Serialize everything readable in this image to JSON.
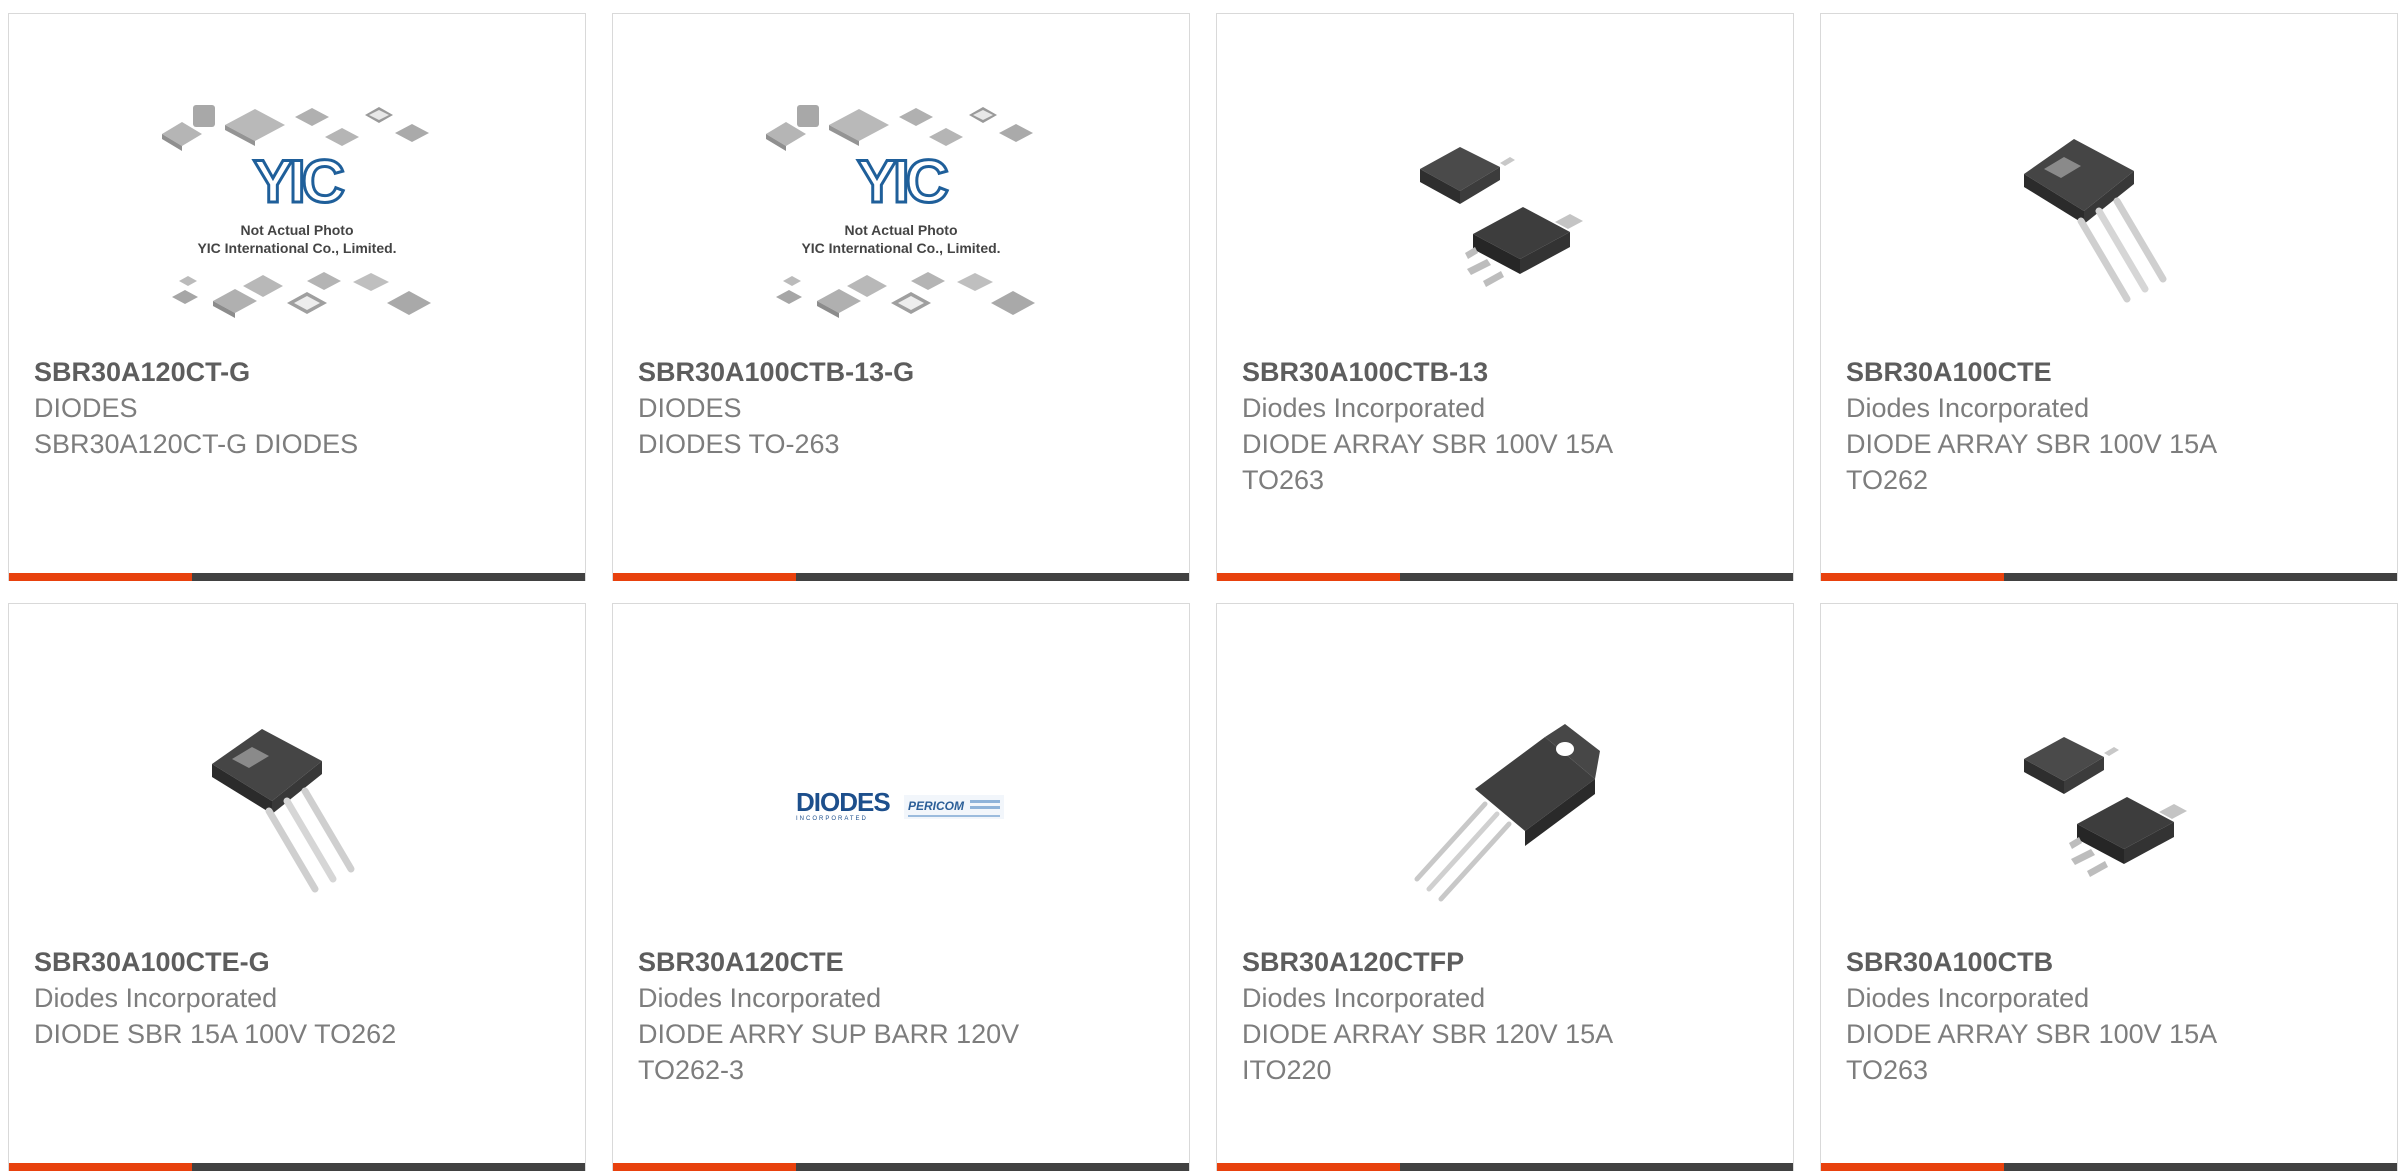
{
  "colors": {
    "accent": "#e8410d",
    "bar_dark": "#414141",
    "title_text": "#5d5d5d",
    "body_text": "#7d7d7d",
    "border": "#d9d9d9"
  },
  "products": [
    {
      "part_number": "SBR30A120CT-G",
      "manufacturer": "DIODES",
      "description": "SBR30A120CT-G DIODES",
      "image": "yic-placeholder",
      "image_text": {
        "logo": "YIC",
        "line1": "Not Actual Photo",
        "line2": "YIC International Co., Limited."
      }
    },
    {
      "part_number": "SBR30A100CTB-13-G",
      "manufacturer": "DIODES",
      "description": "DIODES TO-263",
      "image": "yic-placeholder",
      "image_text": {
        "logo": "YIC",
        "line1": "Not Actual Photo",
        "line2": "YIC International Co., Limited."
      }
    },
    {
      "part_number": "SBR30A100CTB-13",
      "manufacturer": "Diodes Incorporated",
      "description": "DIODE ARRAY SBR 100V 15A TO263",
      "image": "to263-package"
    },
    {
      "part_number": "SBR30A100CTE",
      "manufacturer": "Diodes Incorporated",
      "description": "DIODE ARRAY SBR 100V 15A TO262",
      "image": "to262-package"
    },
    {
      "part_number": "SBR30A100CTE-G",
      "manufacturer": "Diodes Incorporated",
      "description": "DIODE SBR 15A 100V TO262",
      "image": "to262-package"
    },
    {
      "part_number": "SBR30A120CTE",
      "manufacturer": "Diodes Incorporated",
      "description": "DIODE ARRY SUP BARR 120V TO262-3",
      "image": "diodes-pericom-logo",
      "image_text": {
        "logo": "DIODES",
        "sub": "INCORPORATED",
        "logo2": "PERICOM"
      }
    },
    {
      "part_number": "SBR30A120CTFP",
      "manufacturer": "Diodes Incorporated",
      "description": "DIODE ARRAY SBR 120V 15A ITO220",
      "image": "ito220-package"
    },
    {
      "part_number": "SBR30A100CTB",
      "manufacturer": "Diodes Incorporated",
      "description": "DIODE ARRAY SBR 100V 15A TO263",
      "image": "to263-package"
    }
  ]
}
